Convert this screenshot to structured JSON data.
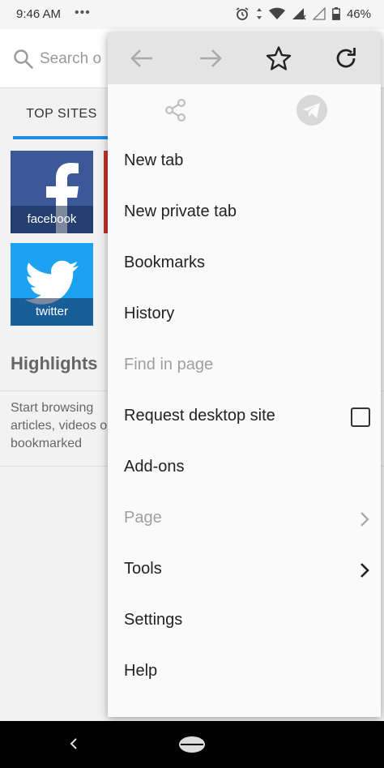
{
  "status_bar": {
    "time": "9:46 AM",
    "dots": "•••",
    "battery": "46%"
  },
  "background": {
    "search_placeholder": "Search or enter address",
    "search_placeholder_visible": "Search o",
    "top_sites_tab": "TOP SITES",
    "tiles": [
      {
        "label": "facebook",
        "color": "#3b5998"
      },
      {
        "label": "twitter",
        "color": "#1da1f2"
      }
    ],
    "highlights_title": "Highlights",
    "highlights_text": "Start browsing articles, videos or bookmarked"
  },
  "menu": {
    "toolbar": [
      "back-icon",
      "forward-icon",
      "star-icon",
      "reload-icon"
    ],
    "share": [
      "share-icon",
      "send-icon"
    ],
    "items": [
      {
        "label": "New tab",
        "enabled": true
      },
      {
        "label": "New private tab",
        "enabled": true
      },
      {
        "label": "Bookmarks",
        "enabled": true
      },
      {
        "label": "History",
        "enabled": true
      },
      {
        "label": "Find in page",
        "enabled": false
      },
      {
        "label": "Request desktop site",
        "enabled": true,
        "checkbox": false
      },
      {
        "label": "Add-ons",
        "enabled": true
      },
      {
        "label": "Page",
        "enabled": false,
        "submenu": true
      },
      {
        "label": "Tools",
        "enabled": true,
        "submenu": true
      },
      {
        "label": "Settings",
        "enabled": true
      },
      {
        "label": "Help",
        "enabled": true
      }
    ]
  },
  "colors": {
    "accent": "#1f8fe6",
    "menu_bg": "#fafafa",
    "toolbar_bg": "#e4e4e4"
  }
}
